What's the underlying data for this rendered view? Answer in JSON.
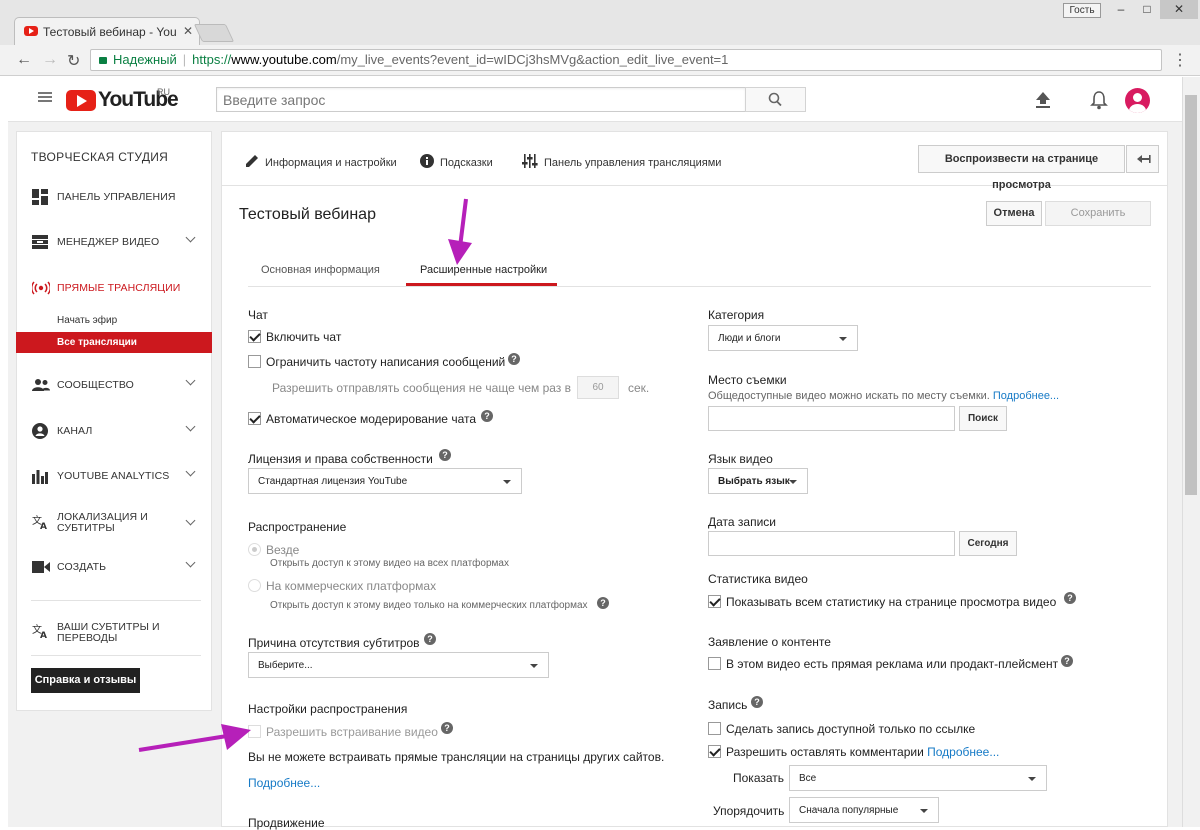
{
  "browser": {
    "tab_title": "Тестовый вебинар - You",
    "guest_label": "Гость",
    "secure_label": "Надежный",
    "url_proto": "https://",
    "url_host": "www.youtube.com",
    "url_path": "/my_live_events?event_id=wIDCj3hsMVg&action_edit_live_event=1",
    "win_min": "–",
    "win_max": "□",
    "win_close": "✕"
  },
  "header": {
    "logo_text": "YouTube",
    "logo_region": "RU",
    "search_placeholder": "Введите запрос"
  },
  "sidebar": {
    "title": "ТВОРЧЕСКАЯ СТУДИЯ",
    "items": [
      {
        "label": "ПАНЕЛЬ УПРАВЛЕНИЯ",
        "icon": "dashboard-icon"
      },
      {
        "label": "МЕНЕДЖЕР ВИДЕО",
        "icon": "video-manager-icon"
      },
      {
        "label": "ПРЯМЫЕ ТРАНСЛЯЦИИ",
        "icon": "live-icon"
      },
      {
        "label": "СООБЩЕСТВО",
        "icon": "community-icon"
      },
      {
        "label": "КАНАЛ",
        "icon": "channel-icon"
      },
      {
        "label": "YOUTUBE ANALYTICS",
        "icon": "analytics-icon"
      },
      {
        "label_line1": "ЛОКАЛИЗАЦИЯ И",
        "label_line2": "СУБТИТРЫ",
        "icon": "translate-icon"
      },
      {
        "label": "СОЗДАТЬ",
        "icon": "create-icon"
      },
      {
        "label_line1": "ВАШИ СУБТИТРЫ И",
        "label_line2": "ПЕРЕВОДЫ",
        "icon": "subtitles-icon"
      }
    ],
    "sub_items": [
      "Начать эфир",
      "Все трансляции"
    ],
    "help_button": "Справка и отзывы",
    "accent": "#cc181e"
  },
  "main": {
    "nav": {
      "info": "Информация и настройки",
      "tips": "Подсказки",
      "control": "Панель управления трансляциями"
    },
    "play_button": "Воспроизвести на странице просмотра",
    "title": "Тестовый вебинар",
    "cancel": "Отмена",
    "save": "Сохранить",
    "tabs": [
      "Основная информация",
      "Расширенные настройки"
    ],
    "left": {
      "chat_heading": "Чат",
      "chat_enable": "Включить чат",
      "chat_limit": "Ограничить частоту написания сообщений",
      "chat_limit_sub": "Разрешить отправлять сообщения не чаще чем раз в",
      "chat_limit_value": "60",
      "chat_limit_unit": "сек.",
      "chat_moderation": "Автоматическое модерирование чата",
      "license_heading": "Лицензия и права собственности",
      "license_value": "Стандартная лицензия YouTube",
      "distribution_heading": "Распространение",
      "dist_everywhere": "Везде",
      "dist_everywhere_sub": "Открыть доступ к этому видео на всех платформах",
      "dist_commercial": "На коммерческих платформах",
      "dist_commercial_sub": "Открыть доступ к этому видео только на коммерческих платформах",
      "subs_heading": "Причина отсутствия субтитров",
      "subs_value": "Выберите...",
      "embed_heading": "Настройки распространения",
      "embed_allow": "Разрешить встраивание видео",
      "embed_note": "Вы не можете встраивать прямые трансляции на страницы других сайтов.",
      "more_link": "Подробнее...",
      "promo_heading": "Продвижение"
    },
    "right": {
      "category_heading": "Категория",
      "category_value": "Люди и блоги",
      "location_heading": "Место съемки",
      "location_sub": "Общедоступные видео можно искать по месту съемки.",
      "location_more": "Подробнее...",
      "search_btn": "Поиск",
      "lang_heading": "Язык видео",
      "lang_value": "Выбрать язык",
      "date_heading": "Дата записи",
      "today_btn": "Сегодня",
      "stats_heading": "Статистика видео",
      "stats_show": "Показывать всем статистику на странице просмотра видео",
      "content_heading": "Заявление о контенте",
      "content_ad": "В этом видео есть прямая реклама или продакт-плейсмент",
      "record_heading": "Запись",
      "record_link_only": "Сделать запись доступной только по ссылке",
      "record_comments": "Разрешить оставлять комментарии",
      "record_more": "Подробнее...",
      "show_label": "Показать",
      "show_value": "Все",
      "sort_label": "Упорядочить",
      "sort_value": "Сначала популярные"
    }
  },
  "annotation_color": "#b620b9"
}
